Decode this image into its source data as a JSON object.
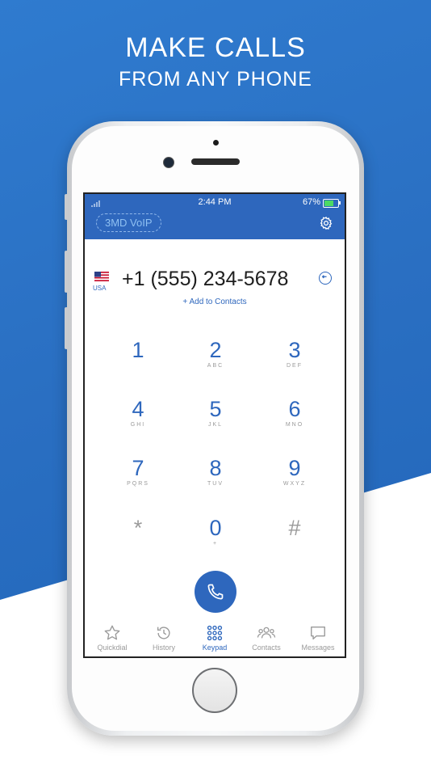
{
  "promo": {
    "headline": "MAKE CALLS",
    "subheadline": "FROM ANY PHONE"
  },
  "status_bar": {
    "time": "2:44 PM",
    "battery": "67%",
    "battery_level": 0.67
  },
  "app_bar": {
    "app_name": "3MD VoIP",
    "settings_icon": "gear-icon"
  },
  "dialer": {
    "country_code": "USA",
    "number": "+1 (555) 234-5678",
    "add_to_contacts": "+ Add to Contacts",
    "keys": [
      {
        "digit": "1",
        "letters": ""
      },
      {
        "digit": "2",
        "letters": "ABC"
      },
      {
        "digit": "3",
        "letters": "DEF"
      },
      {
        "digit": "4",
        "letters": "GHI"
      },
      {
        "digit": "5",
        "letters": "JKL"
      },
      {
        "digit": "6",
        "letters": "MNO"
      },
      {
        "digit": "7",
        "letters": "PQRS"
      },
      {
        "digit": "8",
        "letters": "TUV"
      },
      {
        "digit": "9",
        "letters": "WXYZ"
      },
      {
        "digit": "*",
        "letters": ""
      },
      {
        "digit": "0",
        "letters": "+"
      },
      {
        "digit": "#",
        "letters": ""
      }
    ]
  },
  "tabs": [
    {
      "label": "Quickdial",
      "icon": "star-icon"
    },
    {
      "label": "History",
      "icon": "history-icon"
    },
    {
      "label": "Keypad",
      "icon": "keypad-icon"
    },
    {
      "label": "Contacts",
      "icon": "contacts-icon"
    },
    {
      "label": "Messages",
      "icon": "messages-icon"
    }
  ],
  "colors": {
    "accent": "#2e67bd",
    "background_blue": "#2a6fc2",
    "battery_green": "#4cd964"
  }
}
